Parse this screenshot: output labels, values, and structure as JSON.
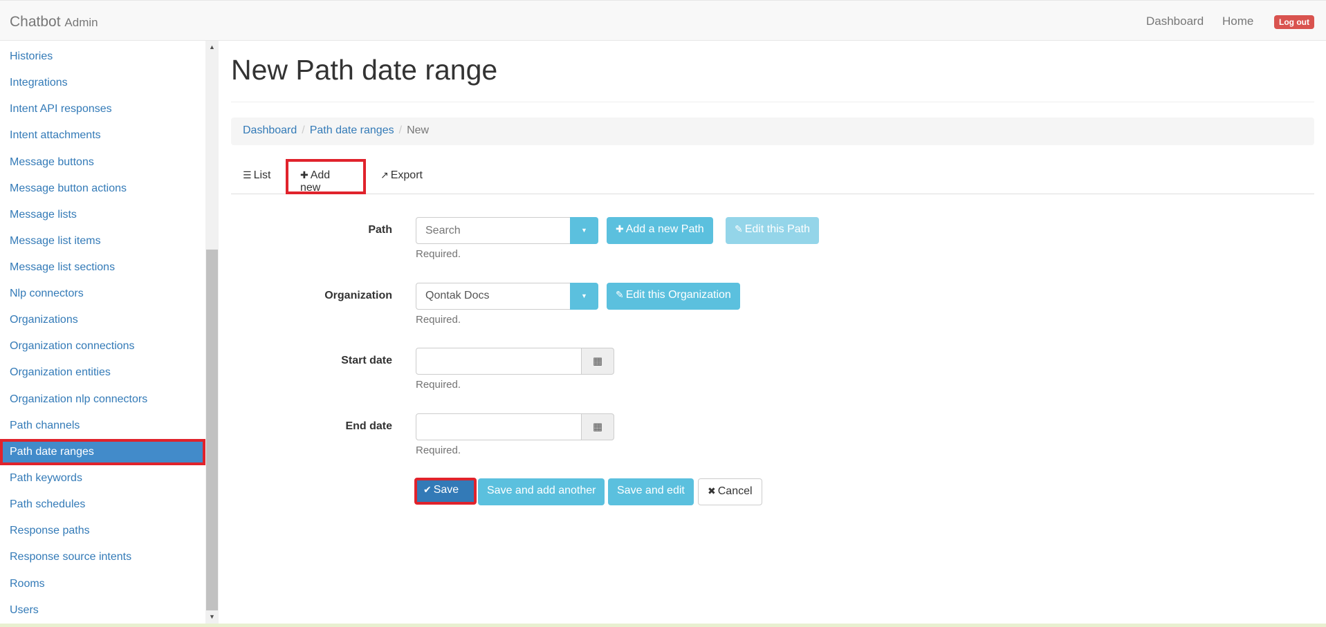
{
  "navbar": {
    "brand": "Chatbot",
    "brand_sub": "Admin",
    "links": [
      "Dashboard",
      "Home"
    ],
    "logout": "Log out"
  },
  "sidebar": {
    "items": [
      "Histories",
      "Integrations",
      "Intent API responses",
      "Intent attachments",
      "Message buttons",
      "Message button actions",
      "Message lists",
      "Message list items",
      "Message list sections",
      "Nlp connectors",
      "Organizations",
      "Organization connections",
      "Organization entities",
      "Organization nlp connectors",
      "Path channels",
      "Path date ranges",
      "Path keywords",
      "Path schedules",
      "Response paths",
      "Response source intents",
      "Rooms",
      "Users"
    ],
    "active": "Path date ranges"
  },
  "page": {
    "title": "New Path date range",
    "breadcrumb": [
      "Dashboard",
      "Path date ranges",
      "New"
    ],
    "tabs": [
      "List",
      "Add new",
      "Export"
    ],
    "active_tab": "Add new"
  },
  "form": {
    "path": {
      "label": "Path",
      "placeholder": "Search",
      "add_button": "Add a new Path",
      "edit_button": "Edit this Path",
      "help": "Required."
    },
    "organization": {
      "label": "Organization",
      "value": "Qontak Docs",
      "edit_button": "Edit this Organization",
      "help": "Required."
    },
    "start_date": {
      "label": "Start date",
      "value": "",
      "help": "Required."
    },
    "end_date": {
      "label": "End date",
      "value": "",
      "help": "Required."
    },
    "actions": {
      "save": "Save",
      "save_add": "Save and add another",
      "save_edit": "Save and edit",
      "cancel": "Cancel"
    }
  },
  "colors": {
    "accent": "#337ab7",
    "info": "#5bc0de",
    "danger": "#d9534f",
    "highlight": "#e0232c"
  }
}
